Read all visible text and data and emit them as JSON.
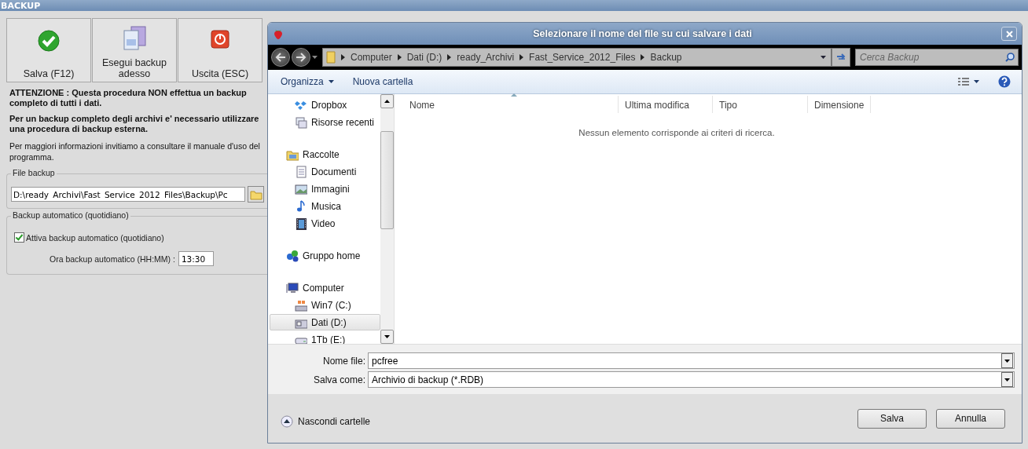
{
  "app": {
    "title": "BACKUP"
  },
  "toolbar": [
    {
      "label": "Salva (F12)",
      "kind": "save"
    },
    {
      "label": "Esegui backup adesso",
      "kind": "run"
    },
    {
      "label": "Uscita (ESC)",
      "kind": "exit"
    }
  ],
  "notes": [
    {
      "text": "ATTENZIONE : Questa procedura NON effettua un backup completo di tutti i dati.",
      "kind": "bold"
    },
    {
      "text": "Per un backup completo degli archivi e' necessario utilizzare una procedura di backup esterna.",
      "kind": "bold"
    },
    {
      "text": "Per maggiori informazioni invitiamo a consultare il manuale d'uso del programma.",
      "kind": "plain"
    }
  ],
  "file_backup": {
    "legend": "File backup",
    "value": "D:\\ready_Archivi\\Fast_Service_2012_Files\\Backup\\Pc"
  },
  "auto_backup": {
    "legend": "Backup automatico (quotidiano)",
    "checkbox": {
      "label": "Attiva backup automatico (quotidiano)",
      "checked": true
    },
    "time_label": "Ora backup automatico (HH:MM) :",
    "time_value": "13:30"
  },
  "dialog": {
    "title": "Selezionare il nome del file su cui salvare i dati",
    "breadcrumb": [
      "Computer",
      "Dati (D:)",
      "ready_Archivi",
      "Fast_Service_2012_Files",
      "Backup"
    ],
    "search": {
      "placeholder": "Cerca Backup"
    },
    "commands": [
      {
        "label": "Organizza",
        "dropdown": true
      },
      {
        "label": "Nuova cartella",
        "dropdown": false
      }
    ],
    "nav": [
      {
        "label": "Dropbox",
        "kind": "favorite",
        "selected": false
      },
      {
        "label": "Risorse recenti",
        "kind": "favorite",
        "selected": false
      },
      {
        "label": "Raccolte",
        "kind": "root",
        "selected": false,
        "children": [
          {
            "label": "Documenti",
            "selected": false
          },
          {
            "label": "Immagini",
            "selected": false
          },
          {
            "label": "Musica",
            "selected": false
          },
          {
            "label": "Video",
            "selected": false
          }
        ]
      },
      {
        "label": "Gruppo home",
        "kind": "root",
        "selected": false
      },
      {
        "label": "Computer",
        "kind": "root",
        "selected": false,
        "children": [
          {
            "label": "Win7 (C:)",
            "selected": false
          },
          {
            "label": "Dati (D:)",
            "selected": true
          },
          {
            "label": "1Tb (E:)",
            "selected": false
          }
        ]
      }
    ],
    "columns": [
      {
        "label": "Nome",
        "sorted": true
      },
      {
        "label": "Ultima modifica",
        "sorted": false
      },
      {
        "label": "Tipo",
        "sorted": false
      },
      {
        "label": "Dimensione",
        "sorted": false
      }
    ],
    "empty_message": "Nessun elemento corrisponde ai criteri di ricerca.",
    "file_name": {
      "label": "Nome file:",
      "value": "pcfree"
    },
    "save_as": {
      "label": "Salva come:",
      "value": "Archivio di backup (*.RDB)"
    },
    "hide_folders": "Nascondi cartelle",
    "buttons": [
      "Salva",
      "Annulla"
    ]
  }
}
